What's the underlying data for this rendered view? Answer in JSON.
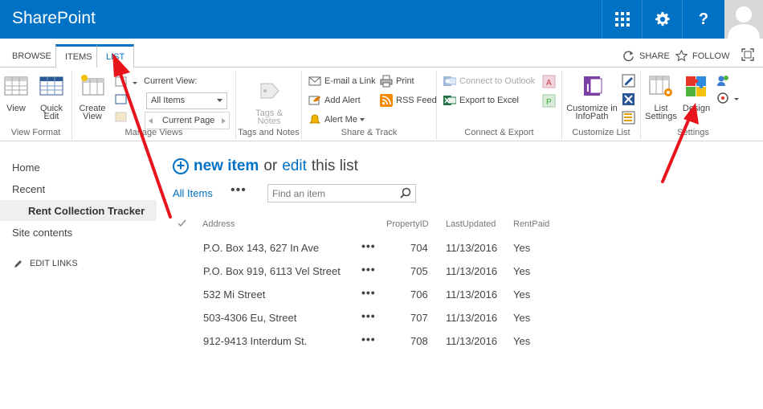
{
  "suite": {
    "brand": "SharePoint",
    "app_launcher_icon": "app-launcher-icon",
    "settings_icon": "gear-icon",
    "help_label": "?"
  },
  "ribbon_tabs": {
    "browse": "BROWSE",
    "items": "ITEMS",
    "list": "LIST",
    "share": "SHARE",
    "follow": "FOLLOW"
  },
  "ribbon": {
    "view_format": {
      "label": "View Format",
      "view": "View",
      "quick_edit_1": "Quick",
      "quick_edit_2": "Edit"
    },
    "manage_views": {
      "label": "Manage Views",
      "create_1": "Create",
      "create_2": "View",
      "current_view_label": "Current View:",
      "current_view_value": "All Items",
      "current_page": "Current Page"
    },
    "tags_notes": {
      "label": "Tags and Notes",
      "btn_1": "Tags &",
      "btn_2": "Notes"
    },
    "share_track": {
      "label": "Share & Track",
      "email": "E-mail a Link",
      "alert": "Add Alert",
      "alert_me": "Alert Me",
      "print": "Print",
      "rss": "RSS Feed"
    },
    "connect_export": {
      "label": "Connect & Export",
      "outlook": "Connect to Outlook",
      "excel": "Export to Excel"
    },
    "customize": {
      "label": "Customize List",
      "infopath_1": "Customize in",
      "infopath_2": "InfoPath"
    },
    "settings": {
      "label": "Settings",
      "list_settings_1": "List",
      "list_settings_2": "Settings",
      "design": "Design"
    }
  },
  "nav": {
    "home": "Home",
    "recent": "Recent",
    "rent": "Rent Collection Tracker",
    "site_contents": "Site contents",
    "edit_links": "EDIT LINKS"
  },
  "content": {
    "new_item": "new item",
    "or": "or",
    "edit": "edit",
    "this_list": "this list",
    "all_items": "All Items",
    "more": "•••",
    "search_placeholder": "Find an item"
  },
  "table": {
    "headers": [
      "Address",
      "PropertyID",
      "LastUpdated",
      "RentPaid"
    ],
    "rows": [
      {
        "address": "P.O. Box 143, 627 In Ave",
        "id": "704",
        "updated": "11/13/2016",
        "paid": "Yes"
      },
      {
        "address": "P.O. Box 919, 6113 Vel Street",
        "id": "705",
        "updated": "11/13/2016",
        "paid": "Yes"
      },
      {
        "address": "532 Mi Street",
        "id": "706",
        "updated": "11/13/2016",
        "paid": "Yes"
      },
      {
        "address": "503-4306 Eu, Street",
        "id": "707",
        "updated": "11/13/2016",
        "paid": "Yes"
      },
      {
        "address": "912-9413 Interdum St.",
        "id": "708",
        "updated": "11/13/2016",
        "paid": "Yes"
      }
    ],
    "row_menu": "•••"
  },
  "colors": {
    "suite_bar": "#0072c6",
    "link": "#0072c6",
    "arrow": "#e8141b"
  }
}
